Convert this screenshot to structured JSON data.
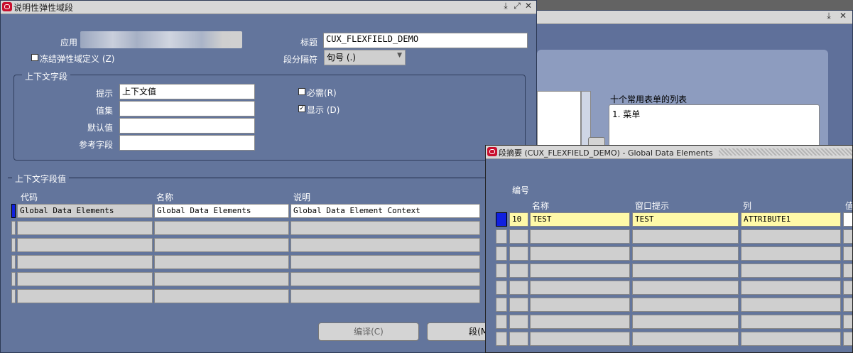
{
  "bg_window": {
    "list_label": "十个常用表单的列表",
    "list_item": "1. 菜单"
  },
  "main_window": {
    "title": "说明性弹性域段",
    "controls": [
      "⤓",
      "⤢",
      "✕"
    ],
    "application_label": "应用",
    "title_label": "标题",
    "title_value": "CUX_FLEXFIELD_DEMO",
    "freeze_label": "冻结弹性域定义 (Z)",
    "separator_label": "段分隔符",
    "separator_value": "句号 (.)",
    "context_group": {
      "heading": "上下文字段",
      "prompt_label": "提示",
      "prompt_value": "上下文值",
      "value_set_label": "值集",
      "default_label": "默认值",
      "ref_field_label": "参考字段",
      "required_label": "必需(R)",
      "displayed_label": "显示 (D)"
    },
    "context_values": {
      "heading": "上下文字段值",
      "columns": [
        "代码",
        "名称",
        "说明"
      ],
      "rows": [
        [
          "Global Data Elements",
          "Global Data Elements",
          "Global Data Element Context"
        ]
      ]
    },
    "compile_button": "编译(C)",
    "segments_button": "段(M)"
  },
  "segments_window": {
    "title": "段摘要 (CUX_FLEXFIELD_DEMO) - Global Data Elements",
    "number_header": "编号",
    "columns": [
      "名称",
      "窗口提示",
      "列",
      "值"
    ],
    "rows": [
      {
        "number": "10",
        "name": "TEST",
        "prompt": "TEST",
        "column": "ATTRIBUTE1"
      }
    ]
  }
}
